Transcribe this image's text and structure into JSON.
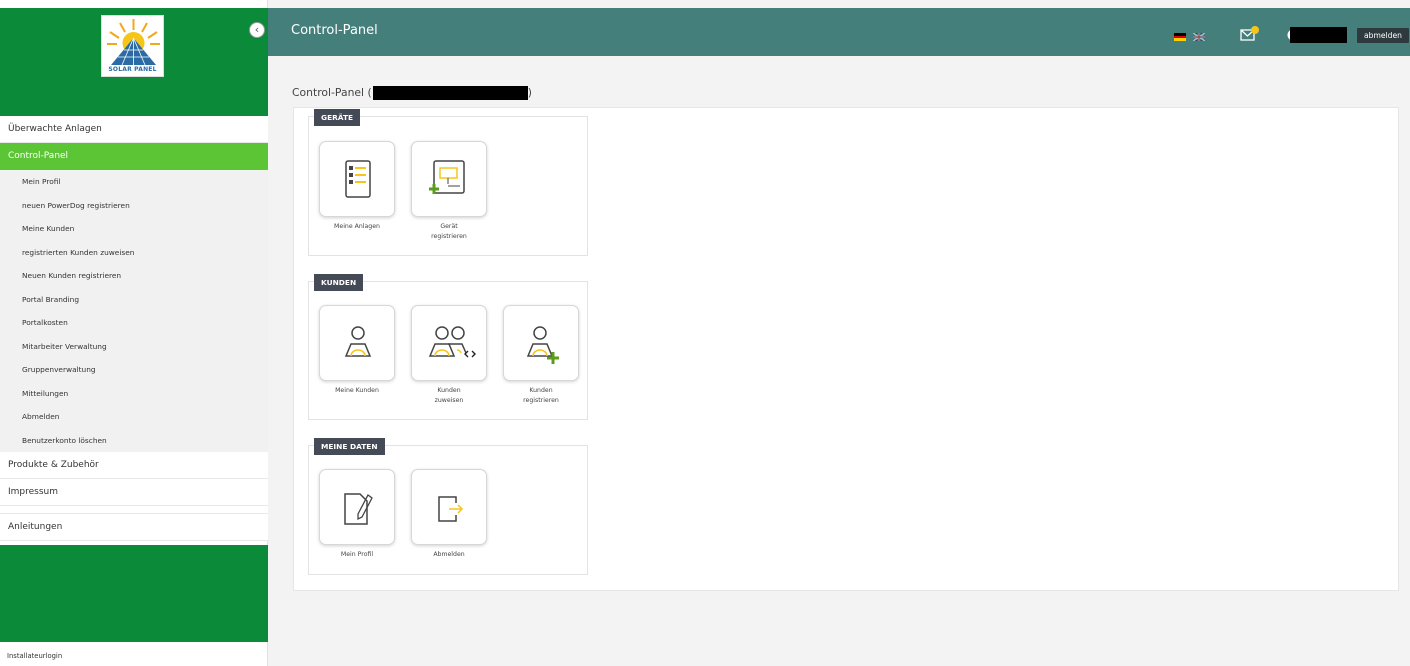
{
  "logo": {
    "text": "SOLAR PANEL"
  },
  "sidebar": {
    "collapse_glyph": "‹",
    "items": [
      {
        "label": "Überwachte Anlagen"
      },
      {
        "label": "Control-Panel",
        "active": true
      },
      {
        "label": "Mein Profil"
      },
      {
        "label": "neuen PowerDog registrieren"
      },
      {
        "label": "Meine Kunden"
      },
      {
        "label": "registrierten Kunden zuweisen"
      },
      {
        "label": "Neuen Kunden registrieren"
      },
      {
        "label": "Portal Branding"
      },
      {
        "label": "Portalkosten"
      },
      {
        "label": "Mitarbeiter Verwaltung"
      },
      {
        "label": "Gruppenverwaltung"
      },
      {
        "label": "Mitteilungen"
      },
      {
        "label": "Abmelden"
      },
      {
        "label": "Benutzerkonto löschen"
      },
      {
        "label": "Produkte & Zubehör"
      },
      {
        "label": "Impressum"
      },
      {
        "label": "Anleitungen"
      }
    ],
    "installer_login": "Installateurlogin"
  },
  "header": {
    "title": "Control-Panel",
    "logout_label": "abmelden",
    "icons": [
      "flag-de-icon",
      "flag-en-icon",
      "mail-icon",
      "user-icon"
    ]
  },
  "main": {
    "page_title_prefix": "Control-Panel (",
    "page_title_suffix": ")",
    "sections": [
      {
        "label": "GERÄTE",
        "tiles": [
          {
            "label": "Meine Anlagen",
            "icon": "list-document-icon"
          },
          {
            "label": "Gerät registrieren",
            "icon": "device-add-icon"
          }
        ]
      },
      {
        "label": "KUNDEN",
        "tiles": [
          {
            "label": "Meine Kunden",
            "icon": "user-icon"
          },
          {
            "label": "Kunden zuweisen",
            "icon": "users-assign-icon"
          },
          {
            "label": "Kunden registrieren",
            "icon": "user-add-icon"
          }
        ]
      },
      {
        "label": "MEINE DATEN",
        "tiles": [
          {
            "label": "Mein Profil",
            "icon": "profile-edit-icon"
          },
          {
            "label": "Abmelden",
            "icon": "logout-icon"
          }
        ]
      }
    ]
  },
  "colors": {
    "header_bg": "#457f7b",
    "sidebar_green": "#0b8a3a",
    "active_green": "#5cc536",
    "accent_yellow": "#f5c518",
    "section_label_bg": "#444b57",
    "plus_green": "#5a9c1e"
  }
}
